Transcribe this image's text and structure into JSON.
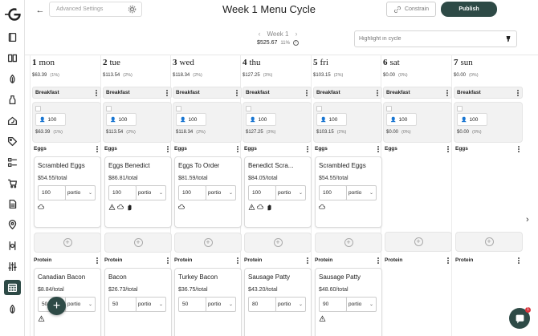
{
  "topbar": {
    "advanced_settings_label": "Advanced Settings",
    "title": "Week 1 Menu Cycle",
    "constrain_label": "Constrain",
    "publish_label": "Publish"
  },
  "week_nav": {
    "label": "Week 1",
    "cost": "$525.67",
    "pct": "11%"
  },
  "highlight": {
    "placeholder": "Highlight in cycle"
  },
  "sidebar": {
    "icons": [
      "logo",
      "book-icon",
      "recipe-book-icon",
      "leaf-icon",
      "bottle-icon",
      "house-leaf-icon",
      "tag-icon",
      "grid-list-icon",
      "cart-icon",
      "document-icon",
      "location-icon",
      "dining-icon",
      "sliders-icon",
      "calendar-icon",
      "leaf-icon-2"
    ]
  },
  "days": [
    {
      "num": "1",
      "name": "mon",
      "cost": "$63.39",
      "pct": "(1%)",
      "breakfast_label": "Breakfast",
      "people": "100",
      "serving_cost": "$63.39",
      "serving_pct": "(1%)",
      "cat1": "Eggs",
      "item1": {
        "name": "Scrambled Eggs",
        "total": "$54.55/total",
        "qty": "100",
        "portion": "portio",
        "icons": [
          "cloud-icon"
        ]
      },
      "cat2": "Protein",
      "item2": {
        "name": "Canadian Bacon",
        "total": "$8.84/total",
        "qty": "50",
        "portion": "portio",
        "icons": [
          "warning-icon"
        ]
      }
    },
    {
      "num": "2",
      "name": "tue",
      "cost": "$113.54",
      "pct": "(2%)",
      "breakfast_label": "Breakfast",
      "people": "100",
      "serving_cost": "$113.54",
      "serving_pct": "(2%)",
      "cat1": "Eggs",
      "item1": {
        "name": "Eggs Benedict",
        "total": "$86.81/total",
        "qty": "100",
        "portion": "portio",
        "icons": [
          "warning-icon",
          "cloud-icon",
          "hand-icon"
        ]
      },
      "cat2": "Protein",
      "item2": {
        "name": "Bacon",
        "total": "$26.73/total",
        "qty": "50",
        "portion": "portio",
        "icons": []
      }
    },
    {
      "num": "3",
      "name": "wed",
      "cost": "$118.34",
      "pct": "(2%)",
      "breakfast_label": "Breakfast",
      "people": "100",
      "serving_cost": "$118.34",
      "serving_pct": "(2%)",
      "cat1": "Eggs",
      "item1": {
        "name": "Eggs To Order",
        "total": "$81.59/total",
        "qty": "100",
        "portion": "portio",
        "icons": [
          "cloud-icon"
        ]
      },
      "cat2": "Protein",
      "item2": {
        "name": "Turkey Bacon",
        "total": "$36.75/total",
        "qty": "50",
        "portion": "portio",
        "icons": []
      }
    },
    {
      "num": "4",
      "name": "thu",
      "cost": "$127.25",
      "pct": "(3%)",
      "breakfast_label": "Breakfast",
      "people": "100",
      "serving_cost": "$127.25",
      "serving_pct": "(3%)",
      "cat1": "Eggs",
      "item1": {
        "name": "Benedict Scra...",
        "total": "$84.05/total",
        "qty": "100",
        "portion": "portio",
        "icons": [
          "warning-icon",
          "cloud-icon",
          "hand-icon"
        ]
      },
      "cat2": "Protein",
      "item2": {
        "name": "Sausage Patty",
        "total": "$43.20/total",
        "qty": "80",
        "portion": "portio",
        "icons": []
      }
    },
    {
      "num": "5",
      "name": "fri",
      "cost": "$103.15",
      "pct": "(2%)",
      "breakfast_label": "Breakfast",
      "people": "100",
      "serving_cost": "$103.15",
      "serving_pct": "(2%)",
      "cat1": "Eggs",
      "item1": {
        "name": "Scrambled Eggs",
        "total": "$54.55/total",
        "qty": "100",
        "portion": "portio",
        "icons": [
          "cloud-icon"
        ]
      },
      "cat2": "Protein",
      "item2": {
        "name": "Sausage Patty",
        "total": "$48.60/total",
        "qty": "90",
        "portion": "portio",
        "icons": [
          "warning-icon"
        ]
      }
    },
    {
      "num": "6",
      "name": "sat",
      "cost": "$0.00",
      "pct": "(0%)",
      "breakfast_label": "Breakfast",
      "people": "100",
      "serving_cost": "$0.00",
      "serving_pct": "(0%)",
      "cat1": "Eggs",
      "cat2": "Protein"
    },
    {
      "num": "7",
      "name": "sun",
      "cost": "$0.00",
      "pct": "(0%)",
      "breakfast_label": "Breakfast",
      "people": "100",
      "serving_cost": "$0.00",
      "serving_pct": "(0%)",
      "cat1": "Eggs",
      "cat2": "Protein"
    }
  ],
  "fab": {
    "label": "+"
  },
  "chat": {
    "badge": "1"
  },
  "colors": {
    "accent": "#2e4a46",
    "badge": "#d9363e"
  }
}
